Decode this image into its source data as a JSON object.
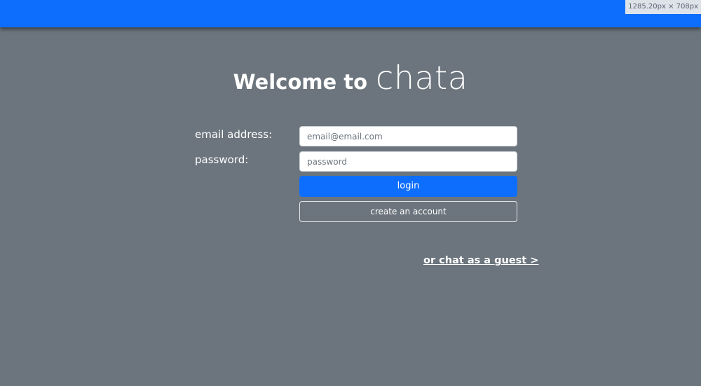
{
  "overlay": {
    "dimensions_text": "1285.20px × 708px"
  },
  "header": {
    "welcome_prefix": "Welcome to",
    "brand_name": "chata"
  },
  "login_form": {
    "email_label": "email address:",
    "email_placeholder": "email@email.com",
    "email_value": "",
    "password_label": "password:",
    "password_placeholder": "password",
    "password_value": "",
    "login_label": "login",
    "create_account_label": "create an account"
  },
  "guest_link": {
    "label": "or chat as a guest >"
  },
  "colors": {
    "background": "#6c757d",
    "primary": "#0d6efd",
    "text": "#ffffff"
  }
}
